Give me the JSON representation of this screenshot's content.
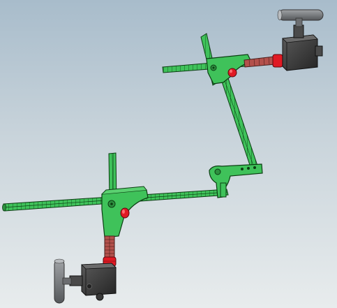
{
  "viewport": {
    "background_top": "#a8bccb",
    "background_bottom": "#e8eced"
  },
  "parts": {
    "rod_color": "#3fc25a",
    "rod_edge": "#0b3d12",
    "valve_body_color": "#3a3a3a",
    "valve_cap_color": "#e01a24",
    "lead_screw_color": "#b3514c",
    "handle_color": "#7b7d80"
  }
}
